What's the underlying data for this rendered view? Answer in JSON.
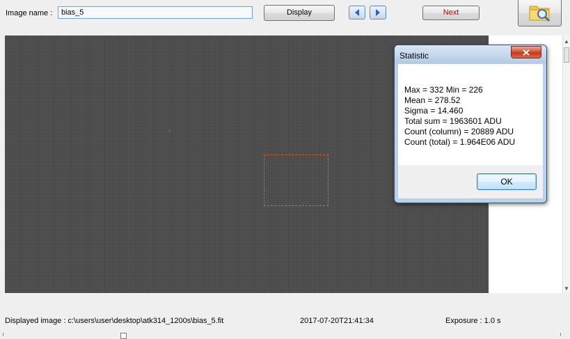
{
  "toolbar": {
    "image_name_label": "Image name :",
    "image_name_value": "bias_5",
    "display_label": "Display",
    "next_label": "Next",
    "prev_icon": "blue-left-arrow-icon",
    "next_icon": "blue-right-arrow-icon",
    "open_icon": "folder-search-icon"
  },
  "status": {
    "displayed_image": "Displayed image : c:\\users\\user\\desktop\\atk314_1200s\\bias_5.fit",
    "timestamp": "2017-07-20T21:41:34",
    "exposure": "Exposure : 1.0 s"
  },
  "statistic_dialog": {
    "title": "Statistic",
    "lines": [
      "Max = 332   Min = 226",
      "Mean = 278.52",
      "Sigma = 14.460",
      "Total sum = 1963601 ADU",
      "Count (column) = 20889 ADU",
      "Count (total) = 1.964E06 ADU"
    ],
    "ok_label": "OK",
    "close_icon": "close-icon"
  },
  "colors": {
    "next_text": "#c00000",
    "selection_border": "#e0601a",
    "image_background": "#4a4a4a"
  }
}
